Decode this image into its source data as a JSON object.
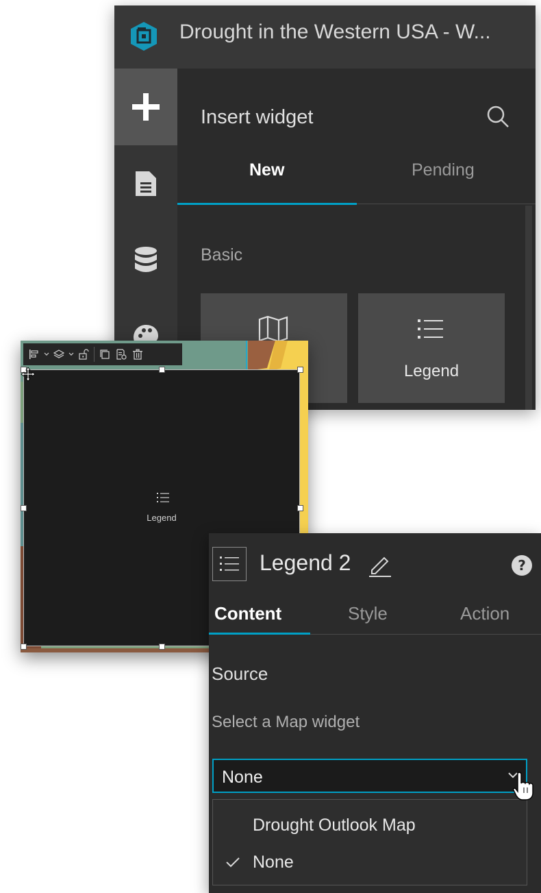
{
  "builder": {
    "app_title": "Drought in the Western USA  - W...",
    "sidebar": {
      "items": [
        {
          "icon": "plus-icon"
        },
        {
          "icon": "page-icon"
        },
        {
          "icon": "database-icon"
        },
        {
          "icon": "palette-icon"
        }
      ]
    },
    "panel": {
      "title": "Insert widget",
      "tabs": [
        {
          "label": "New",
          "active": true
        },
        {
          "label": "Pending",
          "active": false
        }
      ],
      "section": "Basic",
      "cards": [
        {
          "label": "Map",
          "icon": "map-icon"
        },
        {
          "label": "Legend",
          "icon": "legend-icon"
        }
      ]
    }
  },
  "canvas": {
    "placeholder_label": "Legend",
    "toolbar": [
      "align-icon",
      "layers-icon",
      "unlock-icon",
      "duplicate-icon",
      "copy-style-icon",
      "delete-icon"
    ]
  },
  "settings": {
    "widget_name": "Legend 2",
    "tabs": [
      {
        "label": "Content",
        "active": true
      },
      {
        "label": "Style",
        "active": false
      },
      {
        "label": "Action",
        "active": false
      }
    ],
    "source_label": "Source",
    "select_label": "Select a Map widget",
    "select_value": "None",
    "options": [
      {
        "label": "Drought Outlook Map",
        "selected": false
      },
      {
        "label": "None",
        "selected": true
      }
    ]
  },
  "colors": {
    "accent": "#00a0c6",
    "panel_bg": "#2b2b2b",
    "header_bg": "#383838",
    "logo_teal": "#1597b8"
  }
}
